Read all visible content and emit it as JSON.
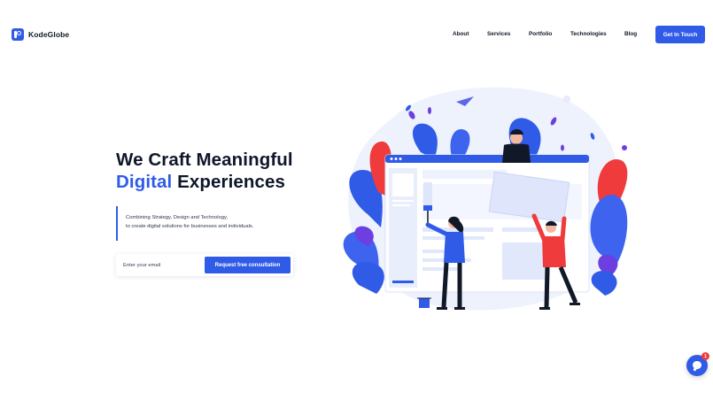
{
  "brand": {
    "name": "KodeGlobe"
  },
  "nav": {
    "items": [
      {
        "label": "About"
      },
      {
        "label": "Services"
      },
      {
        "label": "Portfolio"
      },
      {
        "label": "Technologies"
      },
      {
        "label": "Blog"
      }
    ],
    "cta_label": "Get In Touch"
  },
  "hero": {
    "headline_line1": "We Craft Meaningful",
    "headline_accent": "Digital",
    "headline_rest": " Experiences",
    "tagline_line1": "Combining Strategy, Design and Technology,",
    "tagline_line2": "to create digital solutions for businesses and individuals.",
    "email_placeholder": "Enter your email",
    "submit_label": "Request free consultation"
  },
  "chat": {
    "badge_count": "1"
  },
  "colors": {
    "accent": "#2f5be7",
    "red": "#ef3b3b",
    "purple": "#6d3fe0",
    "light_blue": "#e9eefc"
  }
}
